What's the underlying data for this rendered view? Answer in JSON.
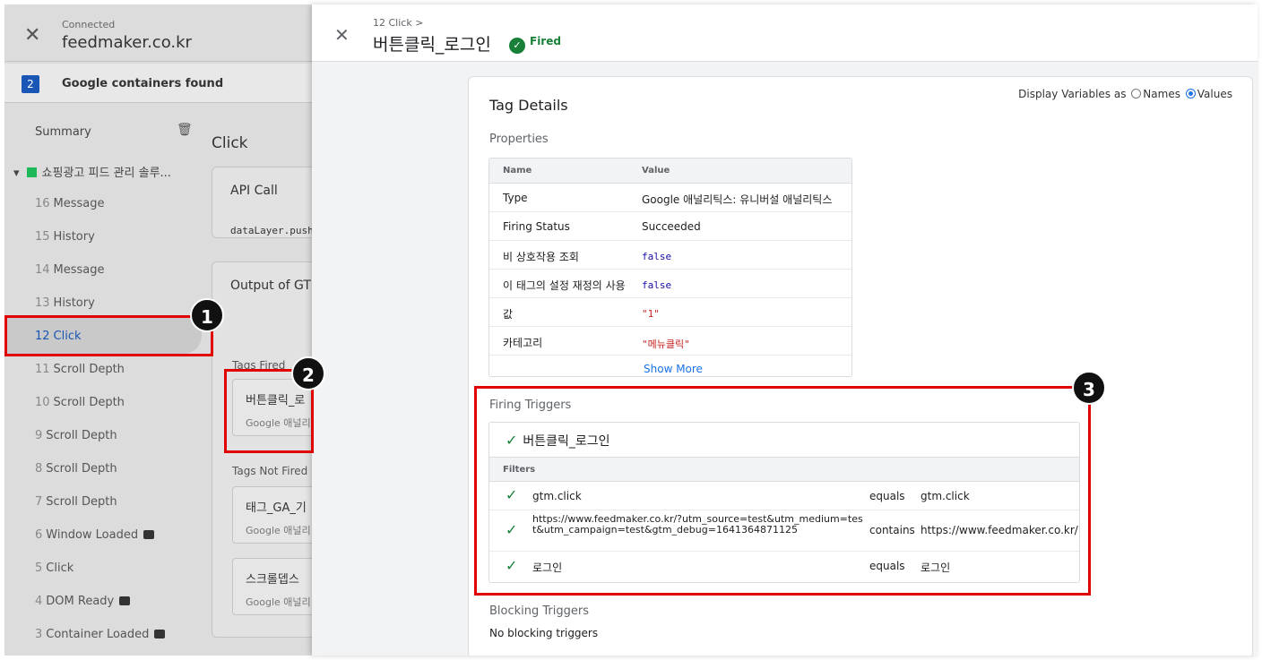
{
  "left": {
    "connected_label": "Connected",
    "domain": "feedmaker.co.kr",
    "containers_count": "2",
    "containers_label": "Google containers found",
    "summary_label": "Summary",
    "container_name": "쇼핑광고 피드 관리 솔루...",
    "events": [
      {
        "num": "16",
        "label": "Message"
      },
      {
        "num": "15",
        "label": "History"
      },
      {
        "num": "14",
        "label": "Message"
      },
      {
        "num": "13",
        "label": "History"
      },
      {
        "num": "12",
        "label": "Click"
      },
      {
        "num": "11",
        "label": "Scroll Depth"
      },
      {
        "num": "10",
        "label": "Scroll Depth"
      },
      {
        "num": "9",
        "label": "Scroll Depth"
      },
      {
        "num": "8",
        "label": "Scroll Depth"
      },
      {
        "num": "7",
        "label": "Scroll Depth"
      },
      {
        "num": "6",
        "label": "Window Loaded"
      },
      {
        "num": "5",
        "label": "Click"
      },
      {
        "num": "4",
        "label": "DOM Ready"
      },
      {
        "num": "3",
        "label": "Container Loaded"
      }
    ]
  },
  "middle": {
    "title": "Click",
    "api_call": "API Call",
    "datalayer": "dataLayer.push",
    "output": "Output of GT",
    "tags_fired": "Tags Fired",
    "tag1_name": "버튼클릭_로",
    "tag1_type": "Google 애널리",
    "tags_not_fired": "Tags Not Fired",
    "tag2_name": "태그_GA_기",
    "tag2_type": "Google 애널리",
    "tag3_name": "스크롤뎁스",
    "tag3_type": "Google 애널리"
  },
  "detail": {
    "breadcrumb": "12 Click >",
    "title": "버튼클릭_로그인",
    "status": "Fired",
    "heading": "Tag Details",
    "display_vars_label": "Display Variables as",
    "opt_names": "Names",
    "opt_values": "Values",
    "properties_label": "Properties",
    "col_name": "Name",
    "col_value": "Value",
    "properties": [
      {
        "name": "Type",
        "value": "Google 애널리틱스: 유니버설 애널리틱스"
      },
      {
        "name": "Firing Status",
        "value": "Succeeded"
      },
      {
        "name": "비 상호작용 조회",
        "value": "false"
      },
      {
        "name": "이 태그의 설정 재정의 사용",
        "value": "false"
      },
      {
        "name": "값",
        "value": "\"1\""
      },
      {
        "name": "카테고리",
        "value": "\"메뉴클릭\""
      }
    ],
    "show_more": "Show More",
    "firing_triggers_label": "Firing Triggers",
    "trigger_name": "버튼클릭_로그인",
    "filters_label": "Filters",
    "filters": [
      {
        "variable": "gtm.click",
        "operator": "equals",
        "value": "gtm.click"
      },
      {
        "variable": "https://www.feedmaker.co.kr/?utm_source=test&utm_medium=test&utm_campaign=test&gtm_debug=1641364871125",
        "operator": "contains",
        "value": "https://www.feedmaker.co.kr/"
      },
      {
        "variable": "로그인",
        "operator": "equals",
        "value": "로그인"
      }
    ],
    "blocking_triggers_label": "Blocking Triggers",
    "blocking_triggers_text": "No blocking triggers"
  },
  "annotations": [
    "1",
    "2",
    "3"
  ],
  "colors": {
    "highlight": "#e00000",
    "fired_green": "#188038",
    "link_blue": "#1a73e8"
  }
}
